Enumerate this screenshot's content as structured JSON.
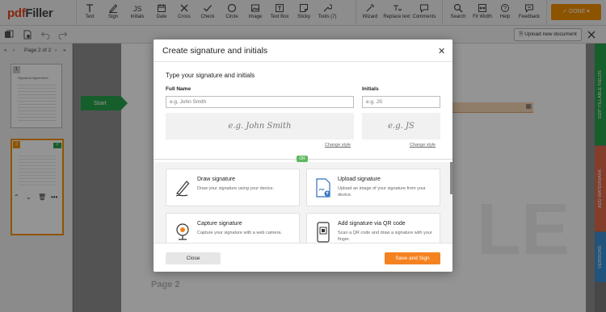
{
  "app": {
    "logo_part1": "pdf",
    "logo_part2": "Filler",
    "done_label": "DONE",
    "accent": "#f39200"
  },
  "toolbar": {
    "tools": [
      {
        "label": "Text",
        "icon": "text-icon"
      },
      {
        "label": "Sign",
        "icon": "sign-pen-icon"
      },
      {
        "label": "Initials",
        "icon": "initials-icon"
      },
      {
        "label": "Date",
        "icon": "calendar-icon"
      },
      {
        "label": "Cross",
        "icon": "cross-icon"
      },
      {
        "label": "Check",
        "icon": "check-icon"
      },
      {
        "label": "Circle",
        "icon": "circle-icon"
      },
      {
        "label": "Image",
        "icon": "image-icon"
      },
      {
        "label": "Text Box",
        "icon": "text-box-icon"
      },
      {
        "label": "Sticky",
        "icon": "sticky-note-icon"
      },
      {
        "label": "Tools (7)",
        "icon": "tools-icon"
      },
      {
        "label": "Wizard",
        "icon": "wizard-icon"
      },
      {
        "label": "Replace text",
        "icon": "replace-text-icon"
      },
      {
        "label": "Comments",
        "icon": "comments-icon"
      },
      {
        "label": "Search",
        "icon": "search-icon"
      },
      {
        "label": "Fit Width",
        "icon": "fit-width-icon"
      },
      {
        "label": "Help",
        "icon": "help-icon"
      },
      {
        "label": "Feedback",
        "icon": "feedback-icon"
      }
    ]
  },
  "subbar": {
    "upload_label": "Upload new document"
  },
  "sidebar": {
    "page_indicator": "Page 2 of 2",
    "thumb1_title": "Signature Agreement",
    "thumb1_num": "1",
    "thumb2_num": "2",
    "thumb2_badge": "+"
  },
  "document": {
    "start_label": "Start",
    "page2_label": "Page 2",
    "watermark_text": "LE"
  },
  "right_rail": {
    "tabs": [
      {
        "label": "EDIT FILLABLE FIELDS",
        "color": "#27a34a"
      },
      {
        "label": "ADD WATERMARK",
        "color": "#e06a4a"
      },
      {
        "label": "VERSIONS",
        "color": "#3b8fd4"
      }
    ]
  },
  "modal": {
    "title": "Create signature and initials",
    "close_symbol": "✕",
    "section_title": "Type your signature and initials",
    "full_name_label": "Full Name",
    "full_name_placeholder": "e.g. John Smith",
    "full_name_preview": "e.g. John Smith",
    "initials_label": "Initials",
    "initials_placeholder": "e.g. JS",
    "initials_preview": "e.g. JS",
    "change_style": "Change style",
    "or_label": "OR",
    "options": [
      {
        "title": "Draw signature",
        "desc": "Draw your signature using your device.",
        "icon": "draw-pen-icon"
      },
      {
        "title": "Upload signature",
        "desc": "Upload an image of your signature from your device.",
        "icon": "upload-signature-icon"
      },
      {
        "title": "Capture signature",
        "desc": "Capture your signature with a web camera.",
        "icon": "webcam-icon"
      },
      {
        "title": "Add signature via QR code",
        "desc": "Scan a QR code and draw a signature with your finger.",
        "icon": "qr-phone-icon"
      }
    ],
    "close_button": "Close",
    "save_button": "Save and Sign"
  }
}
